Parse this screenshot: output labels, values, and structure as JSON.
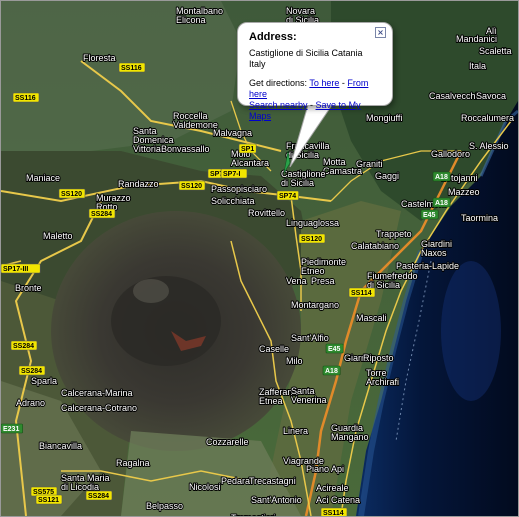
{
  "info_window": {
    "heading": "Address:",
    "address_line1": "Castiglione di Sicilia Catania",
    "address_line2": "Italy",
    "directions_prefix": "Get directions:",
    "to_here": "To here",
    "separator": " - ",
    "from_here": "From here",
    "search_nearby": "Search nearby",
    "save_to_my_maps": "Save to My Maps",
    "close_glyph": "×"
  },
  "place_labels": [
    {
      "id": "montalbano-elicona",
      "text": "Montalbano\nElicona"
    },
    {
      "id": "novara-di-sicilia",
      "text": "Novara\ndi Sicilia"
    },
    {
      "id": "floresta",
      "text": "Floresta"
    },
    {
      "id": "santa-domenica-vittoria",
      "text": "Santa\nDomenica\nVittoria"
    },
    {
      "id": "roccella-valdemone",
      "text": "Roccella\nValdemone"
    },
    {
      "id": "malvagna",
      "text": "Malvagna"
    },
    {
      "id": "bonvassallo",
      "text": "Bonvassallo"
    },
    {
      "id": "mojo-alcantara",
      "text": "Moio\nAlcantara"
    },
    {
      "id": "francavilla-di-sicilia",
      "text": "Francavilla\ndi Sicilia"
    },
    {
      "id": "motta-camastra",
      "text": "Motta\nCamastra"
    },
    {
      "id": "mandanici",
      "text": "Mandanici"
    },
    {
      "id": "mongiuffi",
      "text": "Mongiuffi"
    },
    {
      "id": "casalvecchio",
      "text": "Casalvecchio"
    },
    {
      "id": "savoca",
      "text": "Savoca"
    },
    {
      "id": "roccalumera",
      "text": "Roccalumera"
    },
    {
      "id": "graniti",
      "text": "Graniti"
    },
    {
      "id": "gaggi",
      "text": "Gaggi"
    },
    {
      "id": "castiglione-di-sicilia",
      "text": "Castiglione\ndi Sicilia"
    },
    {
      "id": "randazzo",
      "text": "Randazzo"
    },
    {
      "id": "maniace",
      "text": "Maniace"
    },
    {
      "id": "murazzo-rotto",
      "text": "Murazzo\nRotto"
    },
    {
      "id": "passopisciaro",
      "text": "Passopisciaro"
    },
    {
      "id": "solicchiata",
      "text": "Solicchiata"
    },
    {
      "id": "rovittello",
      "text": "Rovittello"
    },
    {
      "id": "linguaglossa",
      "text": "Linguaglossa"
    },
    {
      "id": "mazzeo",
      "text": "Mazzeo"
    },
    {
      "id": "taormina",
      "text": "Taormina"
    },
    {
      "id": "castelmola",
      "text": "Castelmola"
    },
    {
      "id": "trappeto",
      "text": "Trappeto"
    },
    {
      "id": "calatabiano",
      "text": "Calatabiano"
    },
    {
      "id": "giardini-naxos",
      "text": "Giardini\nNaxos"
    },
    {
      "id": "maletto",
      "text": "Maletto"
    },
    {
      "id": "piedimonte-etneo",
      "text": "Piedimonte\nEtneo"
    },
    {
      "id": "pasteria-lapide",
      "text": "Pasteria-Lapide"
    },
    {
      "id": "fiumefreddo-di-sicilia",
      "text": "Fiumefreddo\ndi Sicilia"
    },
    {
      "id": "vena",
      "text": "Vena"
    },
    {
      "id": "presa",
      "text": "Presa"
    },
    {
      "id": "bronte",
      "text": "Bronte"
    },
    {
      "id": "montargano",
      "text": "Montargano"
    },
    {
      "id": "mascali",
      "text": "Mascali"
    },
    {
      "id": "sant-alfio",
      "text": "Sant'Alfio"
    },
    {
      "id": "caselle",
      "text": "Caselle"
    },
    {
      "id": "milo",
      "text": "Milo"
    },
    {
      "id": "giarre",
      "text": "Giarre"
    },
    {
      "id": "riposto",
      "text": "Riposto"
    },
    {
      "id": "torre-archirafi",
      "text": "Torre\nArchirafi"
    },
    {
      "id": "zafferana-etnea",
      "text": "Zafferana\nEtnea"
    },
    {
      "id": "santa-venerina",
      "text": "Santa\nVenerina"
    },
    {
      "id": "linera",
      "text": "Linera"
    },
    {
      "id": "guardia-mangano",
      "text": "Guardia\nMangano"
    },
    {
      "id": "adrano",
      "text": "Adrano"
    },
    {
      "id": "biancavilla",
      "text": "Biancavilla"
    },
    {
      "id": "ragalna",
      "text": "Ragalna"
    },
    {
      "id": "pedara",
      "text": "Pedara"
    },
    {
      "id": "trecastagni",
      "text": "Trecastagni"
    },
    {
      "id": "nicolosi",
      "text": "Nicolosi"
    },
    {
      "id": "belpasso",
      "text": "Belpasso"
    },
    {
      "id": "santa-maria-di-licodia",
      "text": "Santa Maria\ndi Licodia"
    },
    {
      "id": "acireale",
      "text": "Acireale"
    },
    {
      "id": "aci-catena",
      "text": "Aci Catena"
    },
    {
      "id": "sant-antonio",
      "text": "Sant'Antonio"
    },
    {
      "id": "tremestieri",
      "text": "Tremestieri"
    },
    {
      "id": "viagrande",
      "text": "Viagrande"
    },
    {
      "id": "piano-api",
      "text": "Piano Api"
    },
    {
      "id": "cozzarelle",
      "text": "Cozzarelle"
    },
    {
      "id": "calcerana-marina",
      "text": "Calcerana-Marina"
    },
    {
      "id": "calcerana-cotrano",
      "text": "Calcerana-Cotrano"
    },
    {
      "id": "sparla",
      "text": "Sparla"
    },
    {
      "id": "gallodoro",
      "text": "Gallodoro"
    },
    {
      "id": "letojanni",
      "text": "Letojanni"
    },
    {
      "id": "s-alessio",
      "text": "S. Alessio"
    },
    {
      "id": "ali",
      "text": "Alì"
    },
    {
      "id": "itala",
      "text": "Itala"
    },
    {
      "id": "scaletta",
      "text": "Scaletta"
    }
  ],
  "road_shields": [
    {
      "id": "ss116-a",
      "text": "SS116",
      "style": "yellow"
    },
    {
      "id": "ss116-b",
      "text": "SS116",
      "style": "yellow"
    },
    {
      "id": "sp1",
      "text": "SP1",
      "style": "yellow"
    },
    {
      "id": "sp7-iii",
      "text": "SP7-III",
      "style": "yellow"
    },
    {
      "id": "ss120-a",
      "text": "SS120",
      "style": "yellow"
    },
    {
      "id": "ss120-b",
      "text": "SS120",
      "style": "yellow"
    },
    {
      "id": "ss120-c",
      "text": "SS120",
      "style": "yellow"
    },
    {
      "id": "sp7-i",
      "text": "SP7-I",
      "style": "yellow"
    },
    {
      "id": "sp74",
      "text": "SP74",
      "style": "yellow"
    },
    {
      "id": "ss284-a",
      "text": "SS284",
      "style": "yellow"
    },
    {
      "id": "ss284-b",
      "text": "SS284",
      "style": "yellow"
    },
    {
      "id": "ss284-c",
      "text": "SS284",
      "style": "yellow"
    },
    {
      "id": "ss284-d",
      "text": "SS284",
      "style": "yellow"
    },
    {
      "id": "ss114-a",
      "text": "SS114",
      "style": "yellow"
    },
    {
      "id": "ss114-b",
      "text": "SS114",
      "style": "yellow"
    },
    {
      "id": "ss575",
      "text": "SS575",
      "style": "yellow"
    },
    {
      "id": "ss121",
      "text": "SS121",
      "style": "yellow"
    },
    {
      "id": "sp17-iii",
      "text": "SP17-III",
      "style": "yellow"
    },
    {
      "id": "a18-a",
      "text": "A18",
      "style": "green"
    },
    {
      "id": "a18-b",
      "text": "A18",
      "style": "green"
    },
    {
      "id": "a18-c",
      "text": "A18",
      "style": "green"
    },
    {
      "id": "e45-a",
      "text": "E45",
      "style": "green"
    },
    {
      "id": "e45-b",
      "text": "E45",
      "style": "green"
    },
    {
      "id": "e231",
      "text": "E231",
      "style": "green"
    }
  ],
  "colors": {
    "terrain_green": "#2f4a24",
    "terrain_dark": "#3a3a30",
    "sea": "#061a3a",
    "link": "#0000cc",
    "road_yellow": "#e8c84a",
    "shield_yellow": "#f2e600",
    "shield_green": "#2f8a2f"
  }
}
